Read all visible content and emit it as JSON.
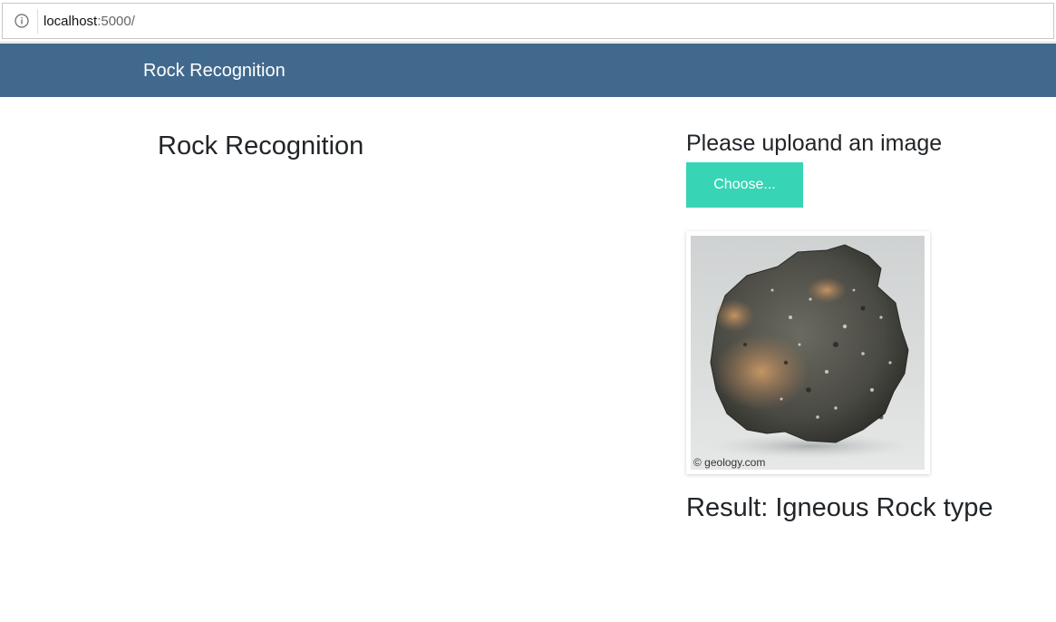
{
  "browser": {
    "url_host": "localhost",
    "url_rest": ":5000/"
  },
  "navbar": {
    "brand": "Rock Recognition"
  },
  "main": {
    "title": "Rock Recognition",
    "upload_heading": "Please uploand an image",
    "choose_label": "Choose...",
    "image_watermark": "© geology.com",
    "result": "Result: Igneous Rock type"
  },
  "colors": {
    "navbar": "#41698d",
    "button": "#38d4b6"
  },
  "icons": {
    "address": "info-icon"
  }
}
